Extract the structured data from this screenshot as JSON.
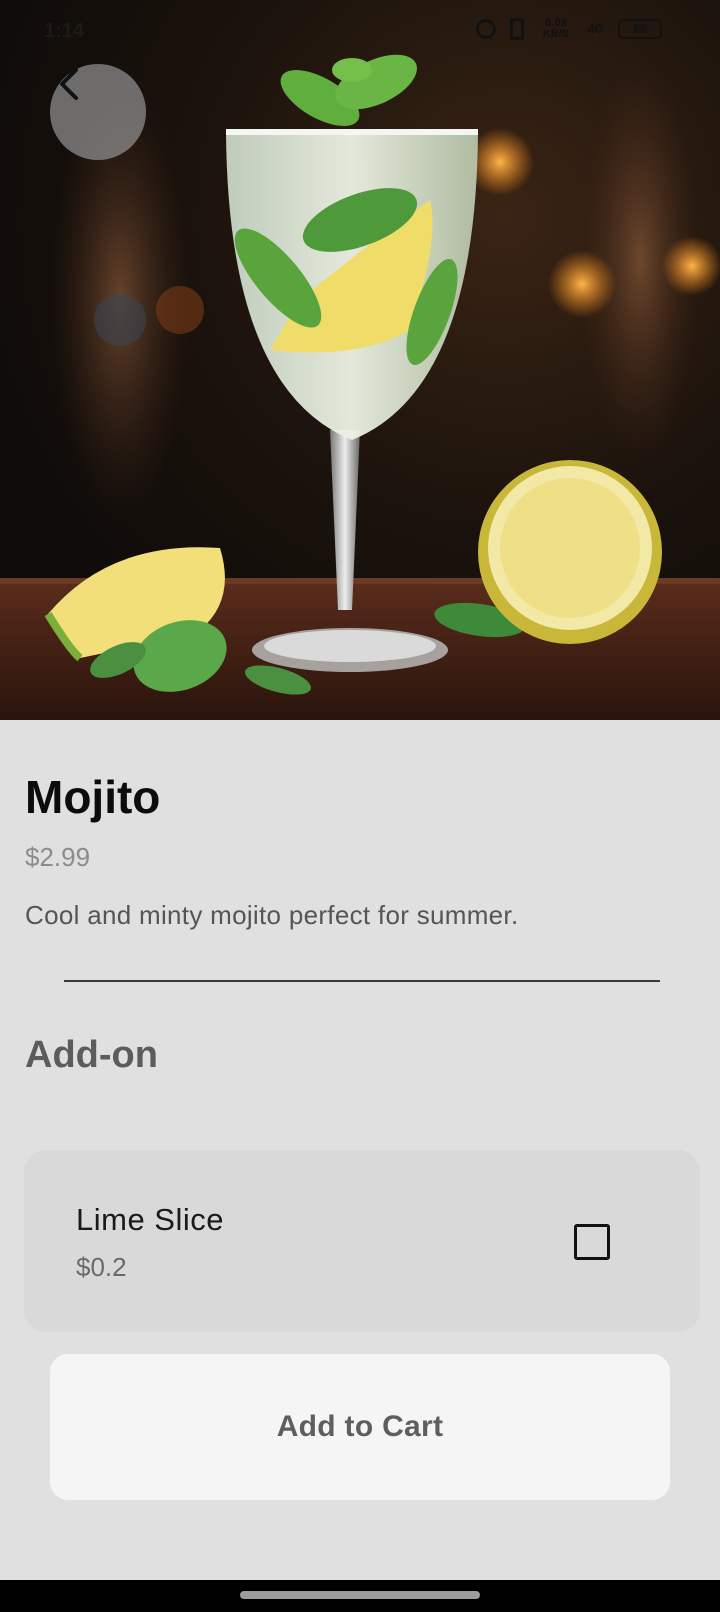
{
  "status_bar": {
    "time": "1:14",
    "net_speed": "0.02 KB/S",
    "signal": "4G",
    "battery": "85"
  },
  "nav": {
    "back_icon": "chevron-left-icon"
  },
  "product": {
    "name": "Mojito",
    "price": "$2.99",
    "description": "Cool and minty mojito perfect for summer."
  },
  "addons": {
    "section_title": "Add-on",
    "items": [
      {
        "name": "Lime Slice",
        "price": "$0.2",
        "checked": false
      }
    ]
  },
  "cart": {
    "button_label": "Add to Cart"
  },
  "colors": {
    "background": "#e0e0e0",
    "card": "#d9d9d9",
    "button": "#f5f5f5"
  }
}
